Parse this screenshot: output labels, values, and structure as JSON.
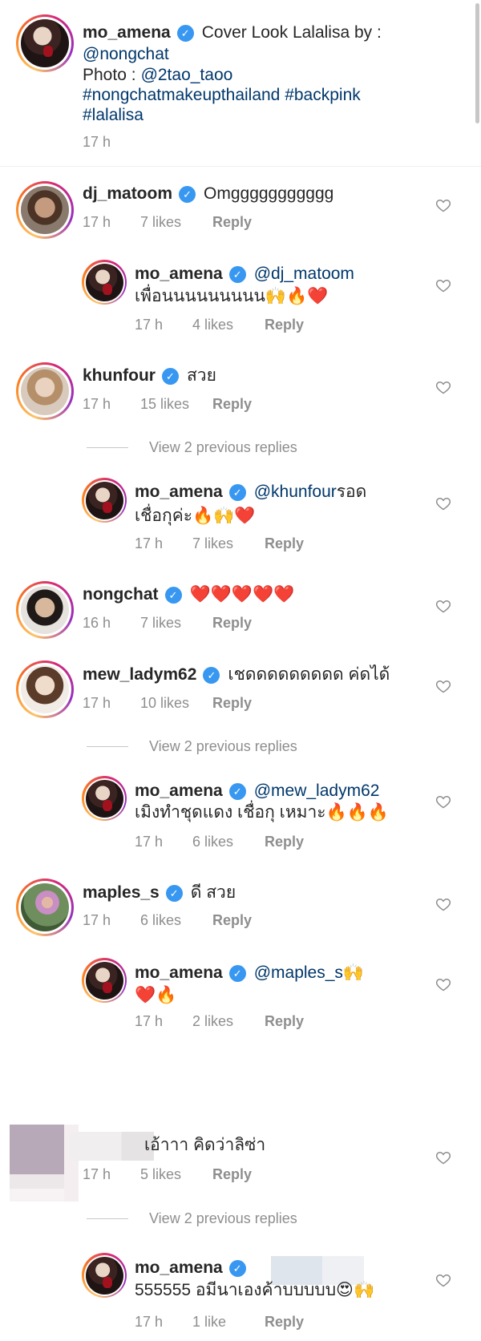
{
  "caption": {
    "user": "mo_amena",
    "line1": "Cover Look Lalalisa by :",
    "line2": "@nongchat",
    "line3_prefix": "Photo : ",
    "line3_mention": "@2tao_taoo",
    "line4": "#nongchatmakeupthailand #backpink",
    "line5": "#lalalisa",
    "time": "17 h"
  },
  "verified_glyph": "✓",
  "view_previous": "View 2 previous replies",
  "reply_label": "Reply",
  "comments": [
    {
      "user": "dj_matoom",
      "text": "Omggggggggggg",
      "time": "17 h",
      "likes": "7 likes"
    },
    {
      "user": "mo_amena",
      "mention": "@dj_matoom",
      "text2": "เพื่อนนนนนนนนน🙌🔥❤️",
      "time": "17 h",
      "likes": "4 likes"
    },
    {
      "user": "khunfour",
      "text": "สวย",
      "time": "17 h",
      "likes": "15 likes"
    },
    {
      "user": "mo_amena",
      "mention": "@khunfour",
      "text": " รอด",
      "text2": "เชื่อกุค่ะ🔥🙌❤️",
      "time": "17 h",
      "likes": "7 likes"
    },
    {
      "user": "nongchat",
      "text": "❤️❤️❤️❤️❤️",
      "time": "16 h",
      "likes": "7 likes"
    },
    {
      "user": "mew_ladym62",
      "text": "เชดดดดดดดดด ค่ดได้",
      "time": "17 h",
      "likes": "10 likes"
    },
    {
      "user": "mo_amena",
      "mention": "@mew_ladym62",
      "text2": "เมิงทำชุดแดง เชื่อกุ เหมาะ🔥🔥🔥",
      "time": "17 h",
      "likes": "6 likes"
    },
    {
      "user": "maples_s",
      "text": "ดี สวย",
      "time": "17 h",
      "likes": "6 likes"
    },
    {
      "user": "mo_amena",
      "mention": "@maples_s",
      "text": " 🙌",
      "text2": "❤️🔥",
      "time": "17 h",
      "likes": "2 likes"
    },
    {
      "user": "",
      "text": "เอ้าาา คิดว่าลิซ่า",
      "time": "17 h",
      "likes": "5 likes"
    },
    {
      "user": "mo_amena",
      "text2": "555555 อมีนาเองค้าบบบบบ😍🙌",
      "time": "17 h",
      "likes": "1 like"
    }
  ]
}
